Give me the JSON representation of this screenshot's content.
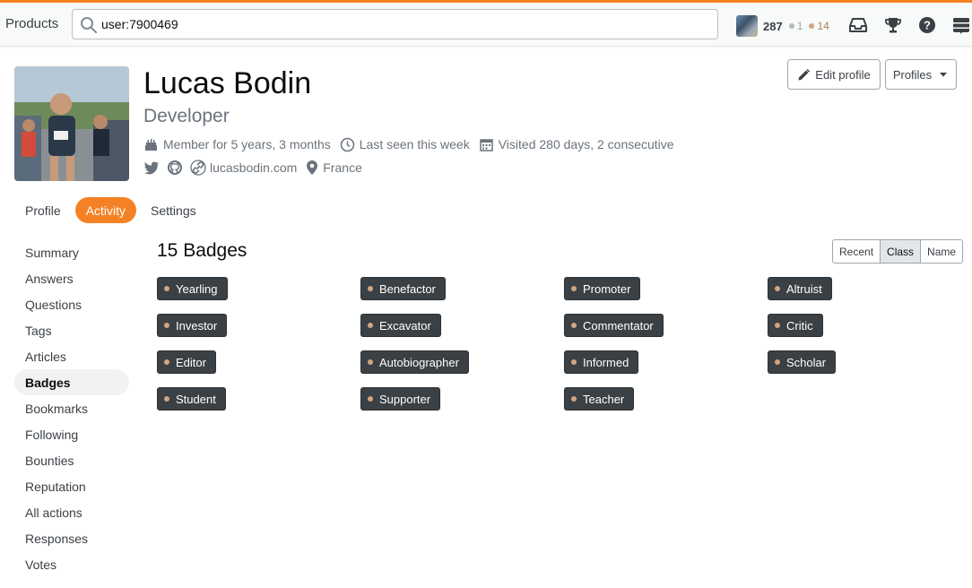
{
  "topbar": {
    "products_label": "Products",
    "search_value": "user:7900469",
    "reputation": "287",
    "silver_count": "1",
    "bronze_count": "14",
    "icons": [
      "inbox-icon",
      "trophy-icon",
      "help-icon",
      "stack-exchange-icon"
    ]
  },
  "profile": {
    "name": "Lucas Bodin",
    "title": "Developer",
    "member_for": "Member for 5 years, 3 months",
    "last_seen": "Last seen this week",
    "visited": "Visited 280 days, 2 consecutive",
    "website": "lucasbodin.com",
    "location": "France",
    "edit_profile_label": "Edit profile",
    "profiles_label": "Profiles"
  },
  "tabs": [
    {
      "label": "Profile",
      "active": false
    },
    {
      "label": "Activity",
      "active": true
    },
    {
      "label": "Settings",
      "active": false
    }
  ],
  "sidenav": [
    {
      "label": "Summary"
    },
    {
      "label": "Answers"
    },
    {
      "label": "Questions"
    },
    {
      "label": "Tags"
    },
    {
      "label": "Articles"
    },
    {
      "label": "Badges",
      "active": true
    },
    {
      "label": "Bookmarks"
    },
    {
      "label": "Following"
    },
    {
      "label": "Bounties"
    },
    {
      "label": "Reputation"
    },
    {
      "label": "All actions"
    },
    {
      "label": "Responses"
    },
    {
      "label": "Votes"
    }
  ],
  "badges_section": {
    "title": "15 Badges",
    "sort_options": [
      "Recent",
      "Class",
      "Name"
    ],
    "active_sort": "Class",
    "badges": [
      "Yearling",
      "Benefactor",
      "Promoter",
      "Altruist",
      "Investor",
      "Excavator",
      "Commentator",
      "Critic",
      "Editor",
      "Autobiographer",
      "Informed",
      "Scholar",
      "Student",
      "Supporter",
      "Teacher"
    ]
  },
  "colors": {
    "accent": "#f48225",
    "badge_bg": "#3b4045",
    "bronze": "#d1a684"
  }
}
